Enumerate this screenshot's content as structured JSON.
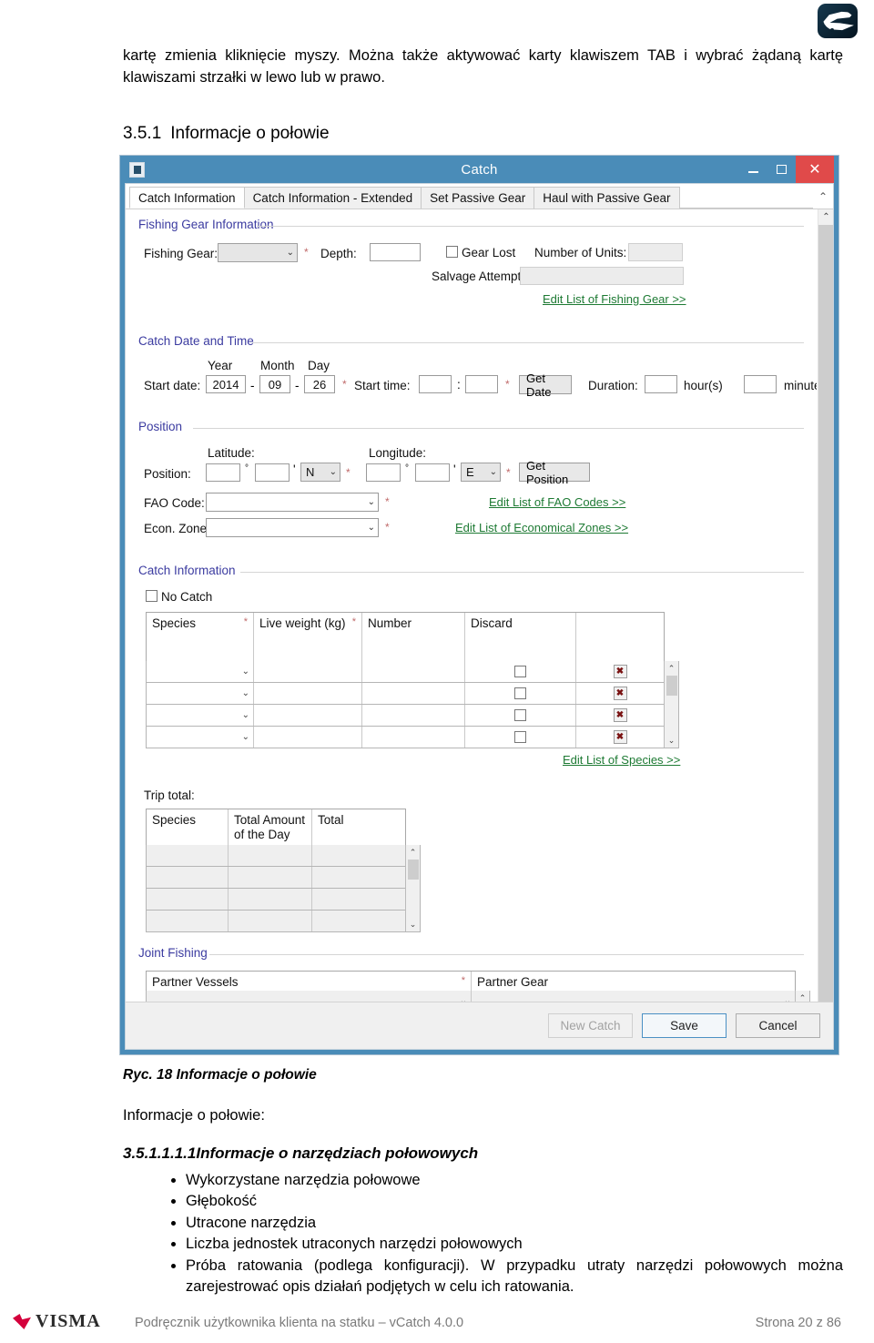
{
  "document": {
    "intro_paragraph": "kartę zmienia kliknięcie myszy. Można także aktywować karty klawiszem TAB i wybrać żądaną kartę klawiszami strzałki w lewo lub w prawo.",
    "section_number": "3.5.1",
    "section_title": "Informacje o połowie",
    "figure_caption": "Ryc. 18 Informacje o połowie",
    "after_figure_line": "Informacje o połowie:",
    "subsection_heading": "3.5.1.1.1.1Informacje o narzędziach połowowych",
    "bullets": [
      "Wykorzystane narzędzia połowowe",
      "Głębokość",
      "Utracone narzędzia",
      "Liczba jednostek utraconych narzędzi połowowych",
      "Próba ratowania (podlega konfiguracji). W przypadku utraty narzędzi połowowych można zarejestrować opis działań podjętych w celu ich ratowania."
    ]
  },
  "footer": {
    "brand": "VISMA",
    "manual": "Podręcznik użytkownika klienta na statku – vCatch 4.0.0",
    "page": "Strona 20 z 86"
  },
  "screenshot": {
    "window": {
      "title": "Catch",
      "minimize_label": "–",
      "maximize_label": "□",
      "close_label": "✕",
      "titlebar_color": "#4a8cb8",
      "close_color": "#e04a4a"
    },
    "tabs": [
      {
        "label": "Catch Information",
        "active": true
      },
      {
        "label": "Catch Information - Extended",
        "active": false
      },
      {
        "label": "Set Passive Gear",
        "active": false
      },
      {
        "label": "Haul with Passive Gear",
        "active": false
      }
    ],
    "fishing_gear": {
      "group_label": "Fishing Gear Information",
      "gear_label": "Fishing Gear:",
      "gear_value": "",
      "gear_required": "*",
      "depth_label": "Depth:",
      "depth_value": "",
      "gear_lost_label": "Gear Lost",
      "gear_lost_checked": false,
      "number_units_label": "Number of Units:",
      "number_units_value": "",
      "salvage_label": "Salvage Attempt:",
      "salvage_value": "",
      "edit_link": "Edit List of Fishing Gear >>"
    },
    "catch_date": {
      "group_label": "Catch Date and Time",
      "year_label": "Year",
      "month_label": "Month",
      "day_label": "Day",
      "start_date_label": "Start date:",
      "year_value": "2014",
      "month_value": "09",
      "day_value": "26",
      "sep": "-",
      "date_required": "*",
      "start_time_label": "Start time:",
      "hour_value": "",
      "minute_value": "",
      "time_sep": ":",
      "time_required": "*",
      "get_date_label": "Get Date",
      "duration_label": "Duration:",
      "duration_hours": "",
      "hours_unit": "hour(s)",
      "duration_minutes": "",
      "minutes_unit": "minute(s)"
    },
    "position": {
      "group_label": "Position",
      "latitude_label": "Latitude:",
      "longitude_label": "Longitude:",
      "position_label": "Position:",
      "lat_deg": "",
      "lat_min": "",
      "lat_dir": "N",
      "lat_required": "*",
      "lon_deg": "",
      "lon_min": "",
      "lon_dir": "E",
      "lon_required": "*",
      "deg_symbol": "°",
      "min_symbol": "'",
      "get_position_label": "Get Position",
      "fao_label": "FAO Code:",
      "fao_value": "",
      "fao_required": "*",
      "fao_link": "Edit List of FAO Codes >>",
      "econ_label": "Econ. Zone:",
      "econ_value": "",
      "econ_required": "*",
      "econ_link": "Edit List of Economical Zones >>"
    },
    "catch_information": {
      "group_label": "Catch Information",
      "no_catch_label": "No Catch",
      "no_catch_checked": false,
      "columns": [
        "Species",
        "Live weight (kg)",
        "Number",
        "Discard",
        ""
      ],
      "required_columns": [
        "Species",
        "Live weight (kg)"
      ],
      "rows": [
        {
          "species": "",
          "live_weight": "",
          "number": "",
          "discard": false,
          "delete": "✖"
        },
        {
          "species": "",
          "live_weight": "",
          "number": "",
          "discard": false,
          "delete": "✖"
        },
        {
          "species": "",
          "live_weight": "",
          "number": "",
          "discard": false,
          "delete": "✖"
        },
        {
          "species": "",
          "live_weight": "",
          "number": "",
          "discard": false,
          "delete": "✖"
        }
      ],
      "edit_link": "Edit List of Species >>"
    },
    "trip_total": {
      "label": "Trip total:",
      "columns": [
        "Species",
        "Total Amount of the Day",
        "Total"
      ],
      "rows": [
        {
          "species": "",
          "amount": "",
          "total": ""
        },
        {
          "species": "",
          "amount": "",
          "total": ""
        },
        {
          "species": "",
          "amount": "",
          "total": ""
        },
        {
          "species": "",
          "amount": "",
          "total": ""
        }
      ]
    },
    "joint_fishing": {
      "group_label": "Joint Fishing",
      "columns": [
        "Partner Vessels",
        "Partner Gear"
      ],
      "partner_required": "*",
      "rows": [
        {
          "vessel": "",
          "gear": ""
        },
        {
          "vessel": "",
          "gear": ""
        }
      ]
    },
    "buttons": {
      "new_catch": "New Catch",
      "save": "Save",
      "cancel": "Cancel"
    }
  }
}
